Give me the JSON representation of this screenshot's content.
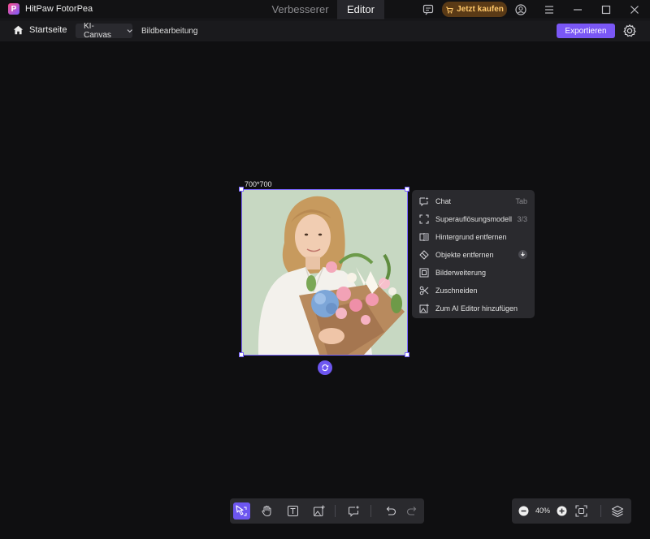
{
  "app": {
    "title": "HitPaw FotorPea",
    "logo_letter": "P"
  },
  "tabs": [
    {
      "label": "Verbesserer",
      "active": false
    },
    {
      "label": "Editor",
      "active": true
    }
  ],
  "titlebar": {
    "buy_label": "Jetzt kaufen"
  },
  "menubar": {
    "home_label": "Startseite",
    "mode_select": "KI-Canvas",
    "section_label": "Bildbearbeitung",
    "export_label": "Exportieren"
  },
  "canvas": {
    "image_size_label": "700*700"
  },
  "context_menu": [
    {
      "label": "Chat",
      "hint": "Tab",
      "icon": "chat-sparkle-icon"
    },
    {
      "label": "Superauflösungsmodell",
      "hint": "3/3",
      "icon": "upscale-icon"
    },
    {
      "label": "Hintergrund entfernen",
      "hint": "",
      "icon": "remove-background-icon"
    },
    {
      "label": "Objekte entfernen",
      "hint": "",
      "icon": "eraser-icon"
    },
    {
      "label": "Bilderweiterung",
      "hint": "",
      "icon": "expand-image-icon"
    },
    {
      "label": "Zuschneiden",
      "hint": "",
      "icon": "scissors-icon"
    },
    {
      "label": "Zum AI Editor hinzufügen",
      "hint": "",
      "icon": "add-image-icon"
    }
  ],
  "zoom": {
    "value": "40%"
  },
  "colors": {
    "accent": "#7a57f5",
    "selection": "#7a66ff",
    "buy_text": "#ffc86a"
  }
}
